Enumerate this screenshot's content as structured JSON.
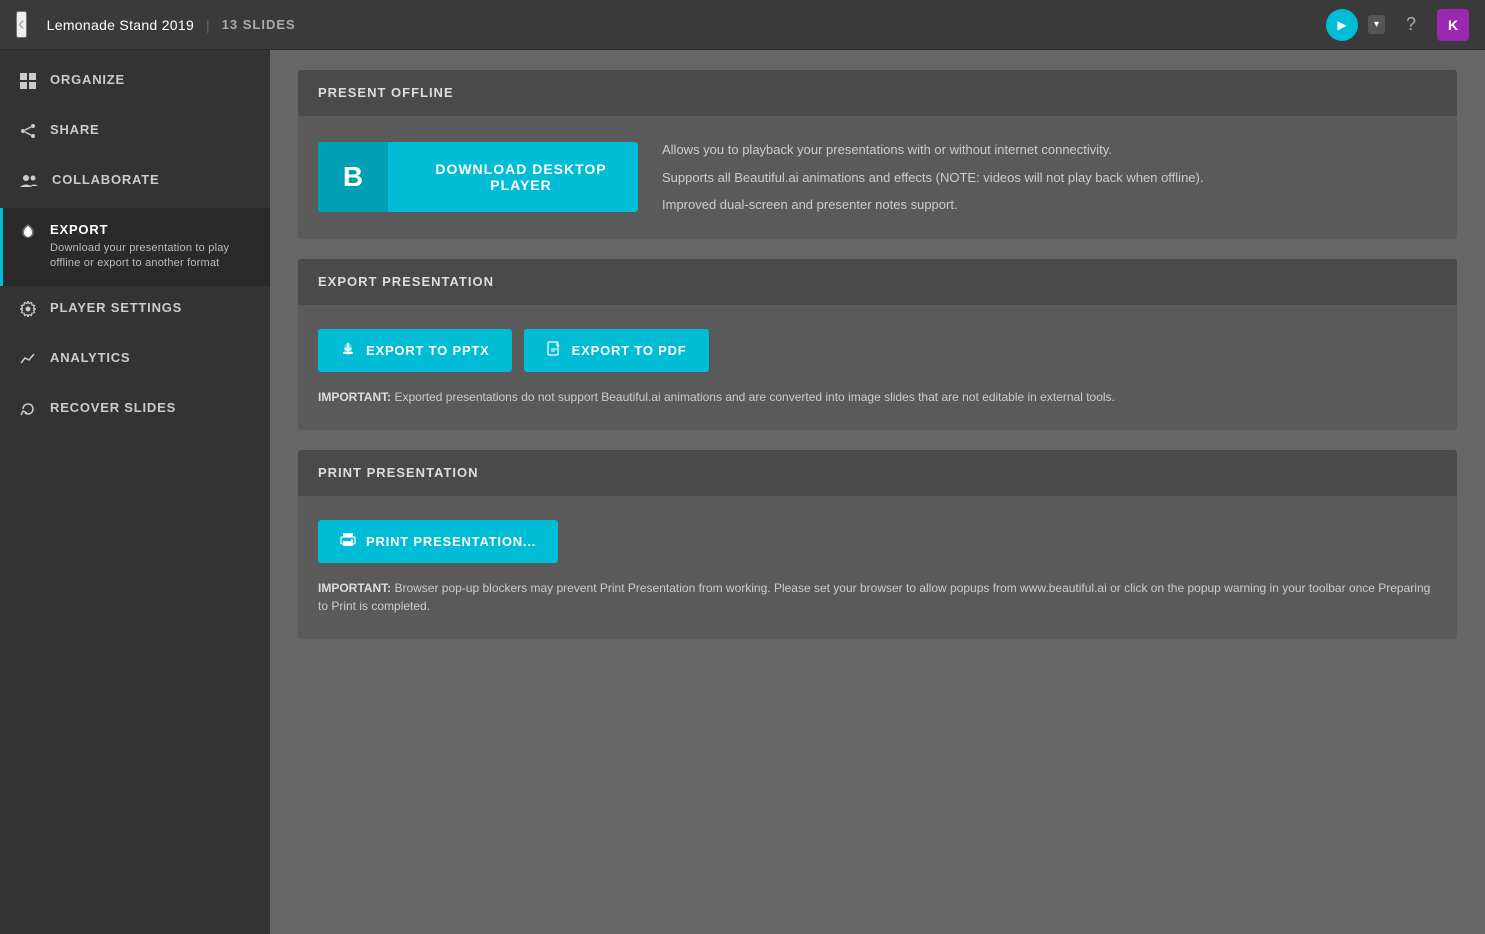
{
  "topbar": {
    "back_icon": "‹",
    "title": "Lemonade Stand 2019",
    "divider": "|",
    "slides_label": "13 SLIDES",
    "play_icon": "▶",
    "dropdown_icon": "▾",
    "help_icon": "?",
    "avatar_label": "K"
  },
  "sidebar": {
    "items": [
      {
        "id": "organize",
        "icon": "⊞",
        "label": "ORGANIZE",
        "sub": ""
      },
      {
        "id": "share",
        "icon": "⤳",
        "label": "SHARE",
        "sub": ""
      },
      {
        "id": "collaborate",
        "icon": "👥",
        "label": "COLLABORATE",
        "sub": ""
      },
      {
        "id": "export",
        "icon": "☁",
        "label": "EXPORT",
        "sub": "Download your presentation to play offline or export to another format"
      },
      {
        "id": "player-settings",
        "icon": "⚙",
        "label": "PLAYER SETTINGS",
        "sub": ""
      },
      {
        "id": "analytics",
        "icon": "📈",
        "label": "ANALYTICS",
        "sub": ""
      },
      {
        "id": "recover-slides",
        "icon": "↺",
        "label": "RECOVER SLIDES",
        "sub": ""
      }
    ]
  },
  "main": {
    "present_offline": {
      "section_title": "PRESENT OFFLINE",
      "download_btn_icon": "B",
      "download_btn_label": "DOWNLOAD DESKTOP PLAYER",
      "info_lines": [
        "Allows you to playback your presentations with or without internet connectivity.",
        "Supports all Beautiful.ai animations and effects (NOTE: videos will not play back when offline).",
        "Improved dual-screen and presenter notes support."
      ]
    },
    "export_presentation": {
      "section_title": "EXPORT PRESENTATION",
      "export_pptx_icon": "☁",
      "export_pptx_label": "EXPORT TO PPTX",
      "export_pdf_icon": "📄",
      "export_pdf_label": "EXPORT TO PDF",
      "important_note": "IMPORTANT:",
      "important_text": " Exported presentations do not support Beautiful.ai animations and are converted into image slides that are not editable in external tools."
    },
    "print_presentation": {
      "section_title": "PRINT PRESENTATION",
      "print_btn_icon": "🖨",
      "print_btn_label": "PRINT PRESENTATION...",
      "important_note": "IMPORTANT:",
      "important_text": " Browser pop-up blockers may prevent Print Presentation from working. Please set your browser to allow popups from www.beautiful.ai or click on the popup warning in your toolbar once Preparing to Print is completed."
    }
  }
}
